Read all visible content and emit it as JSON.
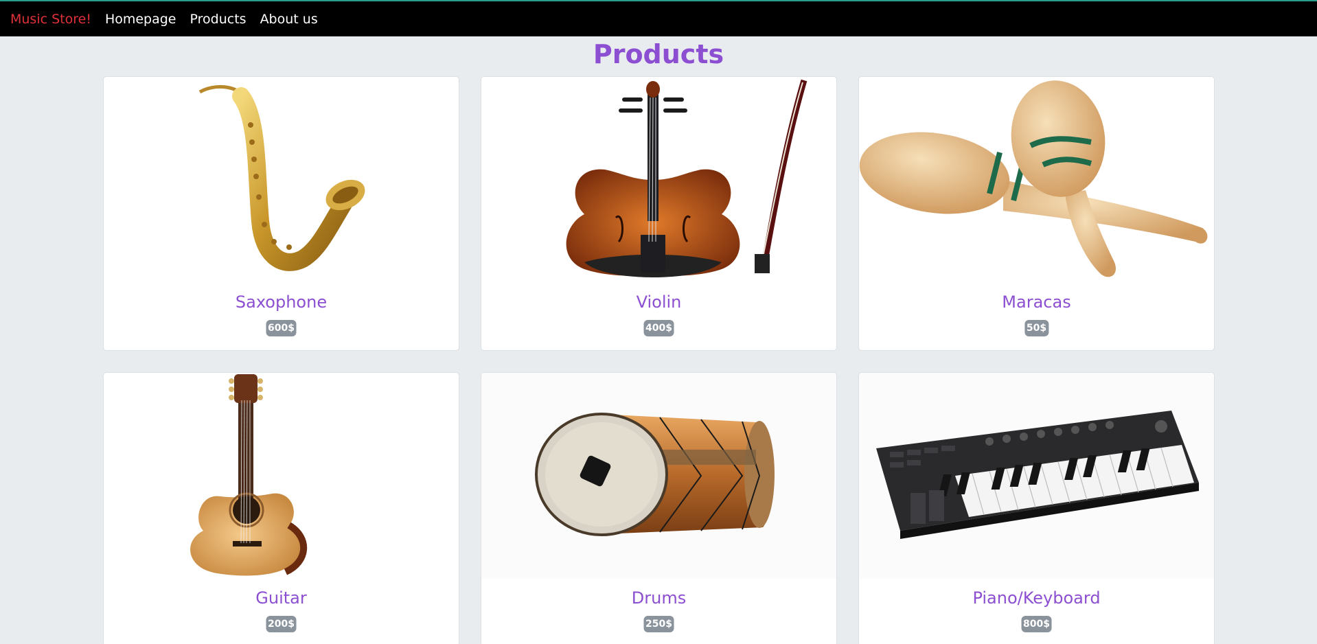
{
  "navbar": {
    "brand": "Music Store!",
    "links": [
      "Homepage",
      "Products",
      "About us"
    ]
  },
  "page": {
    "title": "Products"
  },
  "products": [
    {
      "name": "Saxophone",
      "price": "600$",
      "image_icon": "saxophone-image"
    },
    {
      "name": "Violin",
      "price": "400$",
      "image_icon": "violin-image"
    },
    {
      "name": "Maracas",
      "price": "50$",
      "image_icon": "maracas-image"
    },
    {
      "name": "Guitar",
      "price": "200$",
      "image_icon": "guitar-image"
    },
    {
      "name": "Drums",
      "price": "250$",
      "image_icon": "drum-image"
    },
    {
      "name": "Piano/Keyboard",
      "price": "800$",
      "image_icon": "keyboard-image"
    }
  ],
  "colors": {
    "accent": "#8c4fd1",
    "brand": "#e0303a",
    "navbar_bg": "#000000",
    "page_bg": "#e9ecef",
    "badge_bg": "#8a939c"
  }
}
